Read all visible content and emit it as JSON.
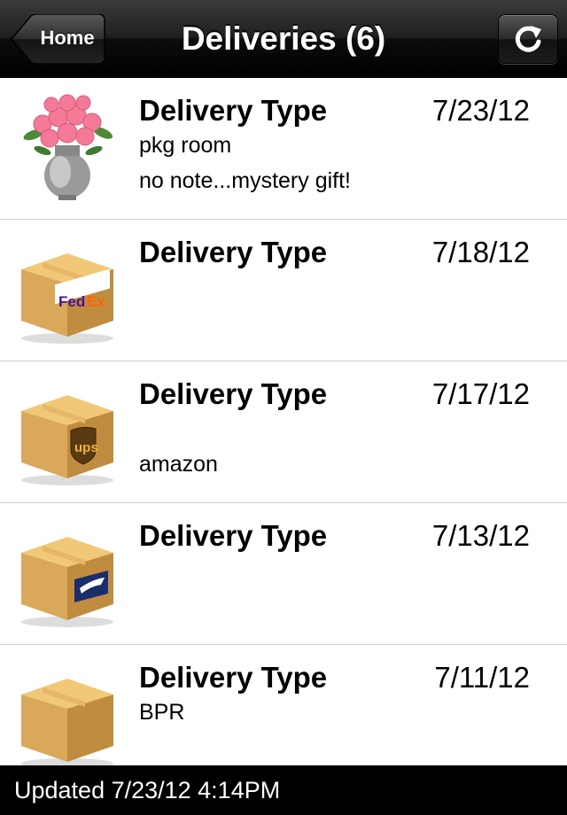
{
  "navbar": {
    "back_label": "Home",
    "title": "Deliveries (6)",
    "refresh_icon": "refresh-icon"
  },
  "deliveries": [
    {
      "title": "Delivery Type",
      "date": "7/23/12",
      "line1": "pkg room",
      "line2": "no note...mystery gift!",
      "icon": "flowers-icon"
    },
    {
      "title": "Delivery Type",
      "date": "7/18/12",
      "line1": "",
      "line2": "",
      "icon": "fedex-package-icon",
      "carrier_label": "FedEx"
    },
    {
      "title": "Delivery Type",
      "date": "7/17/12",
      "line1": "",
      "line2": "amazon",
      "icon": "ups-package-icon",
      "carrier_label": "ups"
    },
    {
      "title": "Delivery Type",
      "date": "7/13/12",
      "line1": "",
      "line2": "",
      "icon": "usps-package-icon"
    },
    {
      "title": "Delivery Type",
      "date": "7/11/12",
      "line1": "BPR",
      "line2": "",
      "icon": "package-icon"
    }
  ],
  "footer": {
    "status": "Updated 7/23/12 4:14PM"
  },
  "colors": {
    "navbar": "#1a1a1a",
    "footer": "#000000",
    "box": "#d9a85b",
    "fedex_purple": "#4d148c",
    "fedex_orange": "#ff6600",
    "ups_brown": "#5a3a13",
    "usps_blue": "#1a2d6b",
    "flower_pink": "#f47a98"
  }
}
